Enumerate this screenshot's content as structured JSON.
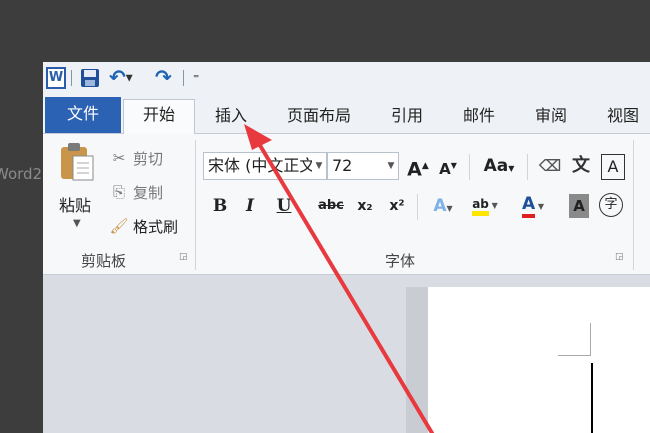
{
  "background_text": "Word2",
  "quick_access": {
    "word_logo": "W",
    "more": "⁼"
  },
  "tabs": [
    {
      "label": "文件"
    },
    {
      "label": "开始"
    },
    {
      "label": "插入"
    },
    {
      "label": "页面布局"
    },
    {
      "label": "引用"
    },
    {
      "label": "邮件"
    },
    {
      "label": "审阅"
    },
    {
      "label": "视图"
    }
  ],
  "clipboard": {
    "paste_label": "粘贴",
    "cut_label": "剪切",
    "copy_label": "复制",
    "format_painter_label": "格式刷",
    "group_label": "剪贴板"
  },
  "font": {
    "font_name": "宋体 (中文正文)",
    "font_size": "72",
    "grow": "A",
    "shrink": "A",
    "change_case": "Aa",
    "phonetic": "文",
    "border_char": "A",
    "bold": "B",
    "italic": "I",
    "underline": "U",
    "strike": "abc",
    "subscript": "x₂",
    "superscript": "x²",
    "text_effect": "A",
    "highlight": "ab",
    "font_color": "A",
    "char_shading": "A",
    "enclose": "字",
    "group_label": "字体"
  },
  "colors": {
    "file_tab": "#2c62b4",
    "annotation_arrow": "#e8393f",
    "highlight": "#ffe600",
    "font_color_bar": "#e02020"
  }
}
